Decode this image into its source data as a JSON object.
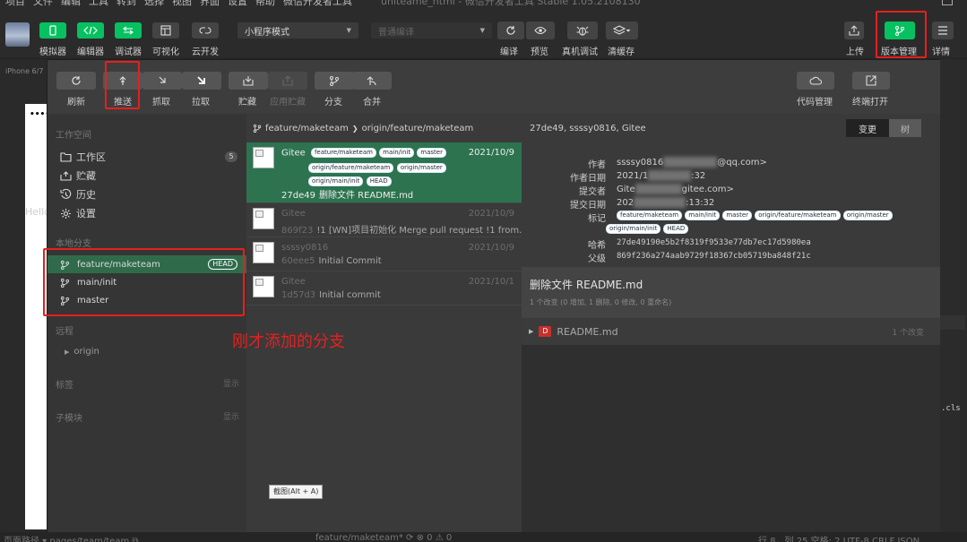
{
  "menu": {
    "items": [
      "项目",
      "文件",
      "编辑",
      "工具",
      "转到",
      "选择",
      "视图",
      "界面",
      "设置",
      "帮助",
      "微信开发者工具"
    ],
    "window_title": "uniteame_html - 微信开发者工具 Stable 1.05.2108130"
  },
  "toolbar": {
    "left_labels": [
      "模拟器",
      "编辑器",
      "调试器",
      "可视化",
      "云开发"
    ],
    "mode_select": "小程序模式",
    "compile_select": "普通编译",
    "mid_labels": [
      "编译",
      "预览",
      "真机调试",
      "清缓存"
    ],
    "right_labels": [
      "上传",
      "版本管理",
      "详情"
    ]
  },
  "simulator": {
    "device": "iPhone 6/7",
    "text": "Hello",
    "dots": "•••••"
  },
  "vm": {
    "tools": [
      {
        "label": "刷新",
        "icon": "refresh-icon",
        "enabled": true
      },
      {
        "label": "推送",
        "icon": "push-icon",
        "enabled": true
      },
      {
        "label": "抓取",
        "icon": "fetch-icon",
        "enabled": true
      },
      {
        "label": "拉取",
        "icon": "pull-icon",
        "enabled": true
      },
      {
        "label": "贮藏",
        "icon": "stash-icon",
        "enabled": true
      },
      {
        "label": "应用贮藏",
        "icon": "apply-stash-icon",
        "enabled": false
      },
      {
        "label": "分支",
        "icon": "branch-icon",
        "enabled": true
      },
      {
        "label": "合并",
        "icon": "merge-icon",
        "enabled": true
      }
    ],
    "right_tools": [
      {
        "label": "代码管理",
        "icon": "cloud-icon"
      },
      {
        "label": "终端打开",
        "icon": "terminal-icon"
      }
    ],
    "sidebar": {
      "workspace_title": "工作空间",
      "workspace_items": [
        {
          "label": "工作区",
          "icon": "folder-icon",
          "count": "5"
        },
        {
          "label": "贮藏",
          "icon": "stash-box-icon"
        },
        {
          "label": "历史",
          "icon": "history-icon"
        },
        {
          "label": "设置",
          "icon": "settings-icon"
        }
      ],
      "local_title": "本地分支",
      "local_branches": [
        {
          "name": "feature/maketeam",
          "head": "HEAD"
        },
        {
          "name": "main/init"
        },
        {
          "name": "master"
        }
      ],
      "remote_title": "远程",
      "remote_item": "origin",
      "tags_title": "标签",
      "submodules_title": "子模块",
      "show_label": "显示"
    },
    "list": {
      "local_branch": "feature/maketeam",
      "remote_branch": "origin/feature/maketeam",
      "commits": [
        {
          "author": "Gitee",
          "date": "2021/10/9",
          "hash": "27de49",
          "message": "删除文件 README.md",
          "tags": [
            "feature/maketeam",
            "main/init",
            "master",
            "origin/feature/maketeam",
            "origin/master",
            "origin/main/init",
            "HEAD"
          ]
        },
        {
          "author": "Gitee",
          "date": "2021/10/9",
          "hash": "869f23",
          "message": "!1 [WN]项目初始化 Merge pull request !1 from..."
        },
        {
          "author": "ssssy0816",
          "date": "2021/10/9",
          "hash": "60eee5",
          "message": "Initial Commit"
        },
        {
          "author": "Gitee",
          "date": "2021/10/1",
          "hash": "1d57d3",
          "message": "Initial commit"
        }
      ]
    },
    "detail": {
      "header": "27de49, ssssy0816, Gitee",
      "seg_changes": "变更",
      "seg_tree": "树",
      "labels": {
        "author": "作者",
        "author_date": "作者日期",
        "committer": "提交者",
        "commit_date": "提交日期",
        "tags": "标记",
        "hash": "哈希",
        "parent": "父级"
      },
      "author": "ssssy0816",
      "author_email_tail": "@qq.com>",
      "author_date_head": "2021/1",
      "author_date_tail": ":32",
      "committer": "Gite",
      "committer_email_tail": "gitee.com>",
      "commit_date_head": "202",
      "commit_date_tail": ":13:32",
      "hash": "27de49190e5b2f8319f9533e77db7ec17d5980ea",
      "parent": "869f236a274aab9729f18367cb05719ba848f21c",
      "message_title": "删除文件 README.md",
      "stats": "1 个改变 (0 增加, 1 删除, 0 修改, 0 重命名)",
      "file": {
        "badge": "D",
        "name": "README.md",
        "count": "1 个改变"
      }
    }
  },
  "annotation": "刚才添加的分支",
  "tooltip": "截图(Alt + A)",
  "statusbar": {
    "left": "页面路径 ▾   pages/team/team  ⧉",
    "mid": "feature/maketeam*  ⟳  ⊗ 0 ⚠ 0",
    "right": "行 8，列 25   空格: 2   UTF-8   CRLF   JSON"
  },
  "right_panel": {
    "cls": ".cls"
  },
  "colors": {
    "accent_green": "#07c160",
    "selected_row": "#2d7350",
    "annotation_red": "#e5201e"
  }
}
